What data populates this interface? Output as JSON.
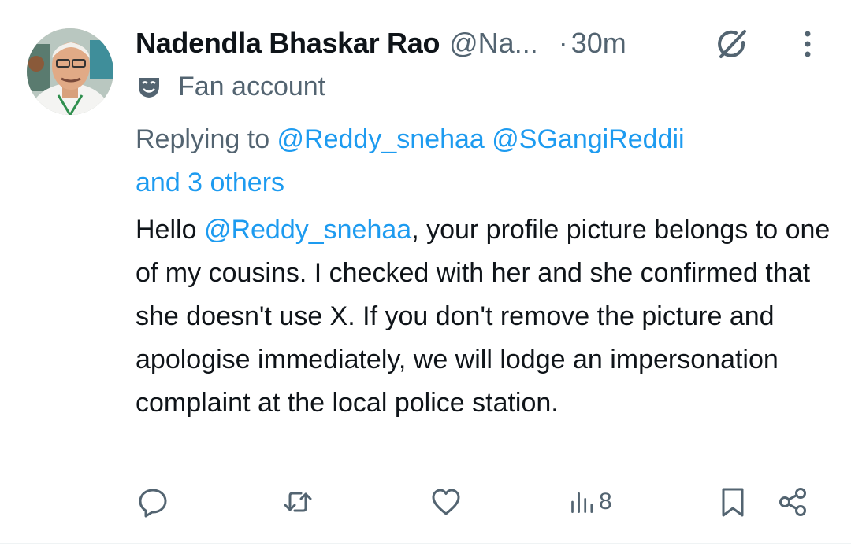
{
  "post": {
    "author_name": "Nadendla Bhaskar Rao",
    "author_handle": "@Na...",
    "separator": "·",
    "time": "30m",
    "account_label": "Fan account",
    "reply": {
      "prefix": "Replying to ",
      "mention_1": "@Reddy_snehaa",
      "mention_2": "@SGangiReddii",
      "others": "and 3 others"
    },
    "text": {
      "p1": "Hello ",
      "mention": "@Reddy_snehaa",
      "p2": ", your profile picture belongs to one of my cousins. I checked with her and she confirmed that she doesn't use X. If you don't remove the picture and apologise immediately, we will lodge an impersonation complaint at the local police station."
    },
    "views": "8"
  },
  "icons": {
    "avatar": "author-avatar",
    "grok": "grok-icon",
    "more": "more-options-icon",
    "label": "fan-account-mask-icon",
    "reply": "reply-icon",
    "repost": "repost-icon",
    "like": "like-icon",
    "views": "views-icon",
    "bookmark": "bookmark-icon",
    "share": "share-icon"
  },
  "colors": {
    "text": "#0f1419",
    "secondary": "#536471",
    "link": "#1d9bf0",
    "background": "#ffffff"
  }
}
